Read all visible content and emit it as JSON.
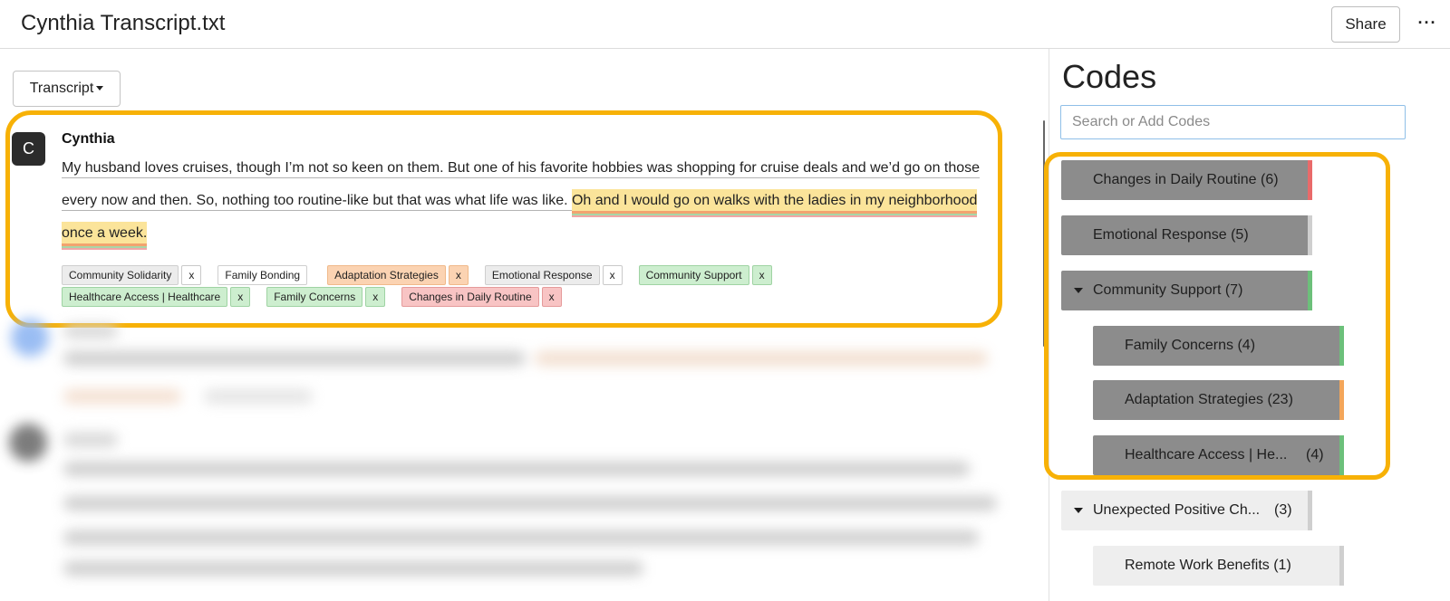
{
  "header": {
    "title": "Cynthia Transcript.txt",
    "share_label": "Share",
    "more_label": "···"
  },
  "transcript": {
    "view_label": "Transcript",
    "entry": {
      "avatar_initial": "C",
      "speaker": "Cynthia",
      "text_plain": "My husband loves cruises, though I’m not so keen on them. But one of his favorite hobbies was shopping for cruise deals and we’d go on those every now and then. So, nothing too routine-like but that was what life was like. ",
      "text_highlight": "Oh and I would go on walks with the ladies in my neighborhood once a week.",
      "remove_label": "x",
      "tags": [
        {
          "label": "Community Solidarity",
          "color": "#ececec"
        },
        {
          "label": "Family Bonding",
          "color": "#ffffff"
        },
        {
          "label": "Adaptation Strategies",
          "color": "#fbd3b2"
        },
        {
          "label": "Emotional Response",
          "color": "#ececec"
        },
        {
          "label": "Community Support",
          "color": "#cdeecf"
        },
        {
          "label": "Healthcare Access | Healthcare",
          "color": "#cdeecf"
        },
        {
          "label": "Family Concerns",
          "color": "#cdeecf"
        },
        {
          "label": "Changes in Daily Routine",
          "color": "#f8c4c4"
        }
      ]
    }
  },
  "codes": {
    "title": "Codes",
    "search_placeholder": "Search or Add Codes",
    "items": [
      {
        "label": "Changes in Daily Routine (6)",
        "count": "",
        "expanded": false,
        "bar_color": "#e96a6a"
      },
      {
        "label": "Emotional Response (5)",
        "count": "",
        "expanded": false,
        "bar_color": "#cfcfcf"
      },
      {
        "label": "Community Support (7)",
        "count": "",
        "expanded": true,
        "bar_color": "#6cc07a"
      },
      {
        "label": "Family Concerns (4)",
        "count": "",
        "expanded": false,
        "bar_color": "#6cc07a"
      },
      {
        "label": "Adaptation Strategies (23)",
        "count": "",
        "expanded": false,
        "bar_color": "#f4a65a"
      },
      {
        "label": "Healthcare Access | He...",
        "count": "(4)",
        "expanded": false,
        "bar_color": "#6cc07a"
      },
      {
        "label": "Unexpected Positive Ch...",
        "count": "(3)",
        "expanded": true,
        "bar_color": "#cfcfcf"
      },
      {
        "label": "Remote Work Benefits (1)",
        "count": "",
        "expanded": false,
        "bar_color": "#cfcfcf"
      }
    ]
  },
  "colors": {
    "accent_outline": "#f7b106",
    "highlight": "#fbe49a",
    "selected_code_bg": "#8c8c8c",
    "code_bg": "#eeeeee"
  }
}
